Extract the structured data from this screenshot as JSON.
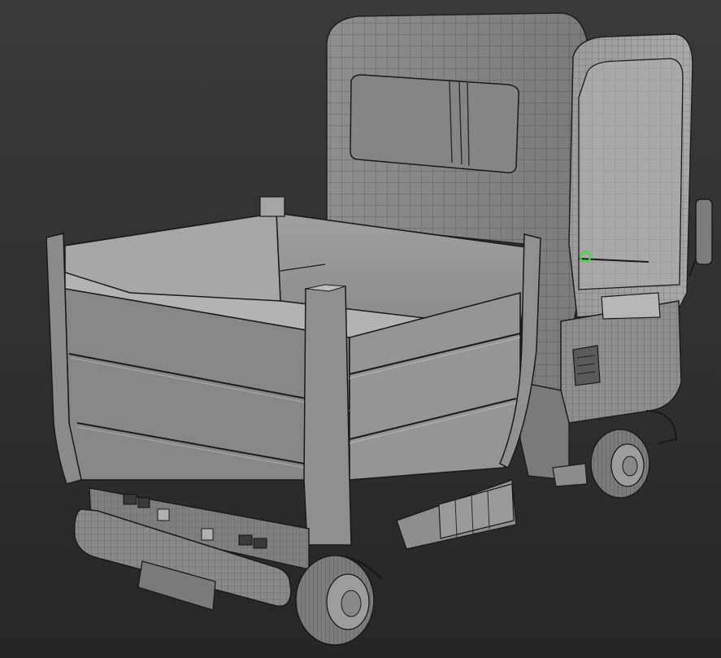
{
  "viewport": {
    "background_top": "#3a3a3a",
    "background_bottom": "#262626"
  },
  "model": {
    "subject": "truck-wireframe",
    "shading_color": "#8a8a8a",
    "wire_color": "#1a1a1a",
    "highlight_color": "#b0b0b0",
    "gizmo_color": "#3ddc3d"
  }
}
